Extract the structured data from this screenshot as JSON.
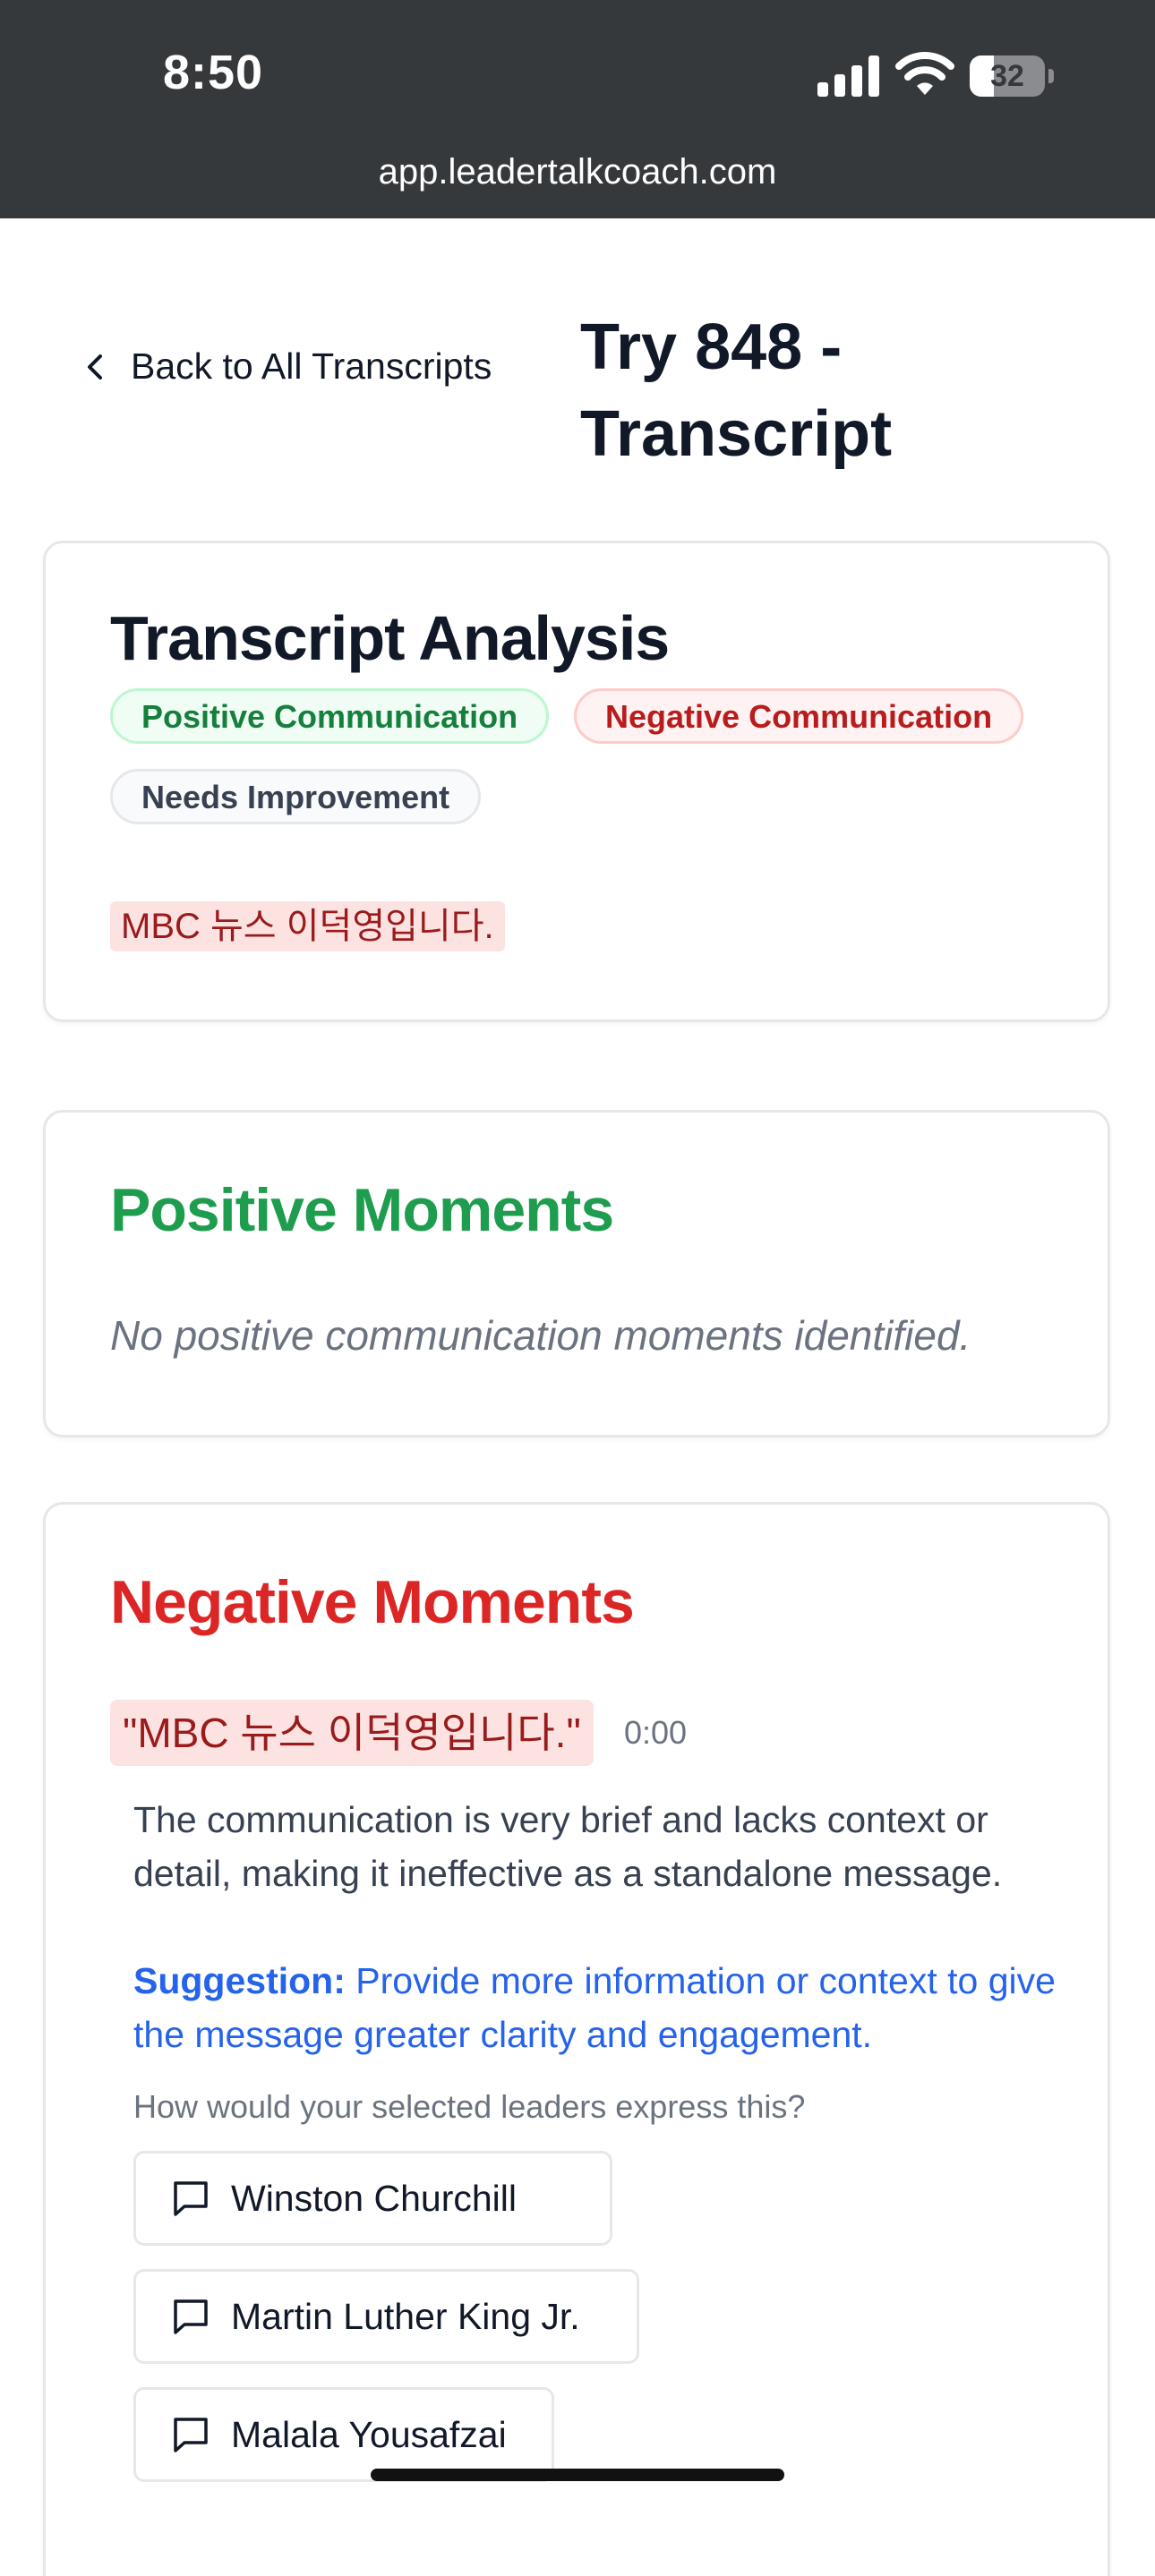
{
  "status_bar": {
    "time": "8:50",
    "battery_level": "32",
    "battery_fraction": 0.32
  },
  "browser": {
    "url": "app.leadertalkcoach.com"
  },
  "header": {
    "back_label": "Back to All Transcripts",
    "title": "Try 848 - Transcript"
  },
  "analysis": {
    "title": "Transcript Analysis",
    "legend": {
      "positive": "Positive Communication",
      "negative": "Negative Communication",
      "improvement": "Needs Improvement"
    },
    "transcript_text": "MBC 뉴스 이덕영입니다."
  },
  "positive_moments": {
    "title": "Positive Moments",
    "empty_message": "No positive communication moments identified."
  },
  "negative_moments": {
    "title": "Negative Moments",
    "items": [
      {
        "quote": "\"MBC 뉴스 이덕영입니다.\"",
        "timestamp": "0:00",
        "description": "The communication is very brief and lacks context or detail, making it ineffective as a standalone message.",
        "suggestion_label": "Suggestion:",
        "suggestion_text": "Provide more information or context to give the message greater clarity and engagement."
      }
    ],
    "leaders_prompt": "How would your selected leaders express this?",
    "leaders": [
      "Winston Churchill",
      "Martin Luther King Jr.",
      "Malala Yousafzai"
    ]
  },
  "colors": {
    "positive": "#1f9d4f",
    "negative": "#dc2626",
    "suggestion": "#2563eb",
    "highlight": "#fde2e2"
  }
}
